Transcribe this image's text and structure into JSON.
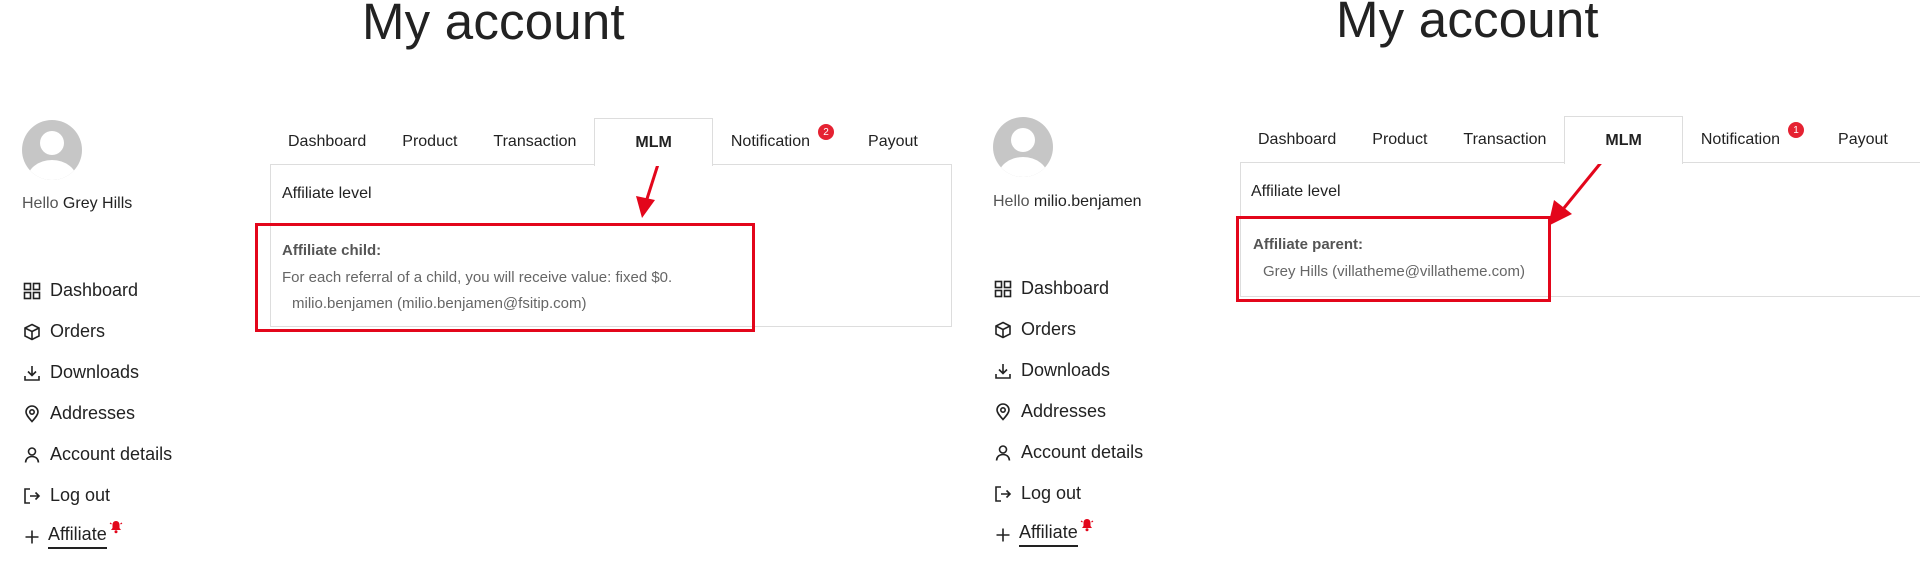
{
  "left": {
    "page_title": "My account",
    "greeting": "Hello",
    "username": "Grey Hills",
    "nav": [
      {
        "label": "Dashboard",
        "icon": "dashboard-icon"
      },
      {
        "label": "Orders",
        "icon": "box-icon"
      },
      {
        "label": "Downloads",
        "icon": "download-icon"
      },
      {
        "label": "Addresses",
        "icon": "map-pin-icon"
      },
      {
        "label": "Account details",
        "icon": "user-icon"
      },
      {
        "label": "Log out",
        "icon": "logout-icon"
      },
      {
        "label": "Affiliate",
        "icon": "plus-icon"
      }
    ],
    "tabs": [
      "Dashboard",
      "Product",
      "Transaction",
      "MLM",
      "Notification",
      "Payout"
    ],
    "notification_count": "2",
    "affiliate_level_label": "Affiliate level",
    "affiliate_title": "Affiliate child:",
    "affiliate_text": "For each referral of a child, you will receive value: fixed $0.",
    "affiliate_member": "milio.benjamen (milio.benjamen@fsitip.com)"
  },
  "right": {
    "page_title": "My account",
    "greeting": "Hello",
    "username": "milio.benjamen",
    "nav": [
      {
        "label": "Dashboard",
        "icon": "dashboard-icon"
      },
      {
        "label": "Orders",
        "icon": "box-icon"
      },
      {
        "label": "Downloads",
        "icon": "download-icon"
      },
      {
        "label": "Addresses",
        "icon": "map-pin-icon"
      },
      {
        "label": "Account details",
        "icon": "user-icon"
      },
      {
        "label": "Log out",
        "icon": "logout-icon"
      },
      {
        "label": "Affiliate",
        "icon": "plus-icon"
      }
    ],
    "tabs": [
      "Dashboard",
      "Product",
      "Transaction",
      "MLM",
      "Notification",
      "Payout"
    ],
    "notification_count": "1",
    "affiliate_level_label": "Affiliate level",
    "affiliate_title": "Affiliate parent:",
    "affiliate_member": "Grey Hills (villatheme@villatheme.com)"
  },
  "colors": {
    "accent_red": "#e3061b",
    "badge_red": "#e52232",
    "border": "#dddddd"
  }
}
